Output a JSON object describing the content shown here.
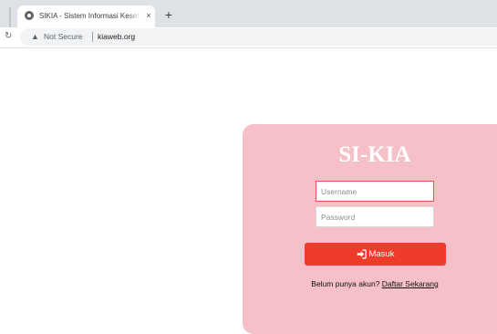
{
  "browser": {
    "tab": {
      "title": "SIKIA - Sistem Informasi Kesehatan",
      "favicon": "globe-icon",
      "close_label": "×"
    },
    "new_tab_label": "+",
    "toolbar": {
      "reload_icon": "reload-icon",
      "security_label": "Not Secure",
      "security_icon": "warning-triangle-icon",
      "url": "kiaweb.org"
    }
  },
  "login": {
    "title": "SI-KIA",
    "username": {
      "value": "",
      "placeholder": "Username"
    },
    "password": {
      "value": "",
      "placeholder": "Password"
    },
    "submit_label": "Masuk",
    "submit_icon": "sign-in-icon",
    "register_prompt": "Belum punya akun?",
    "register_link": "Daftar Sekarang"
  },
  "colors": {
    "card_background": "#f5c0c8",
    "button_background": "#ee3b2b",
    "active_input_border": "#e8554a",
    "title_text": "#ffffff"
  }
}
